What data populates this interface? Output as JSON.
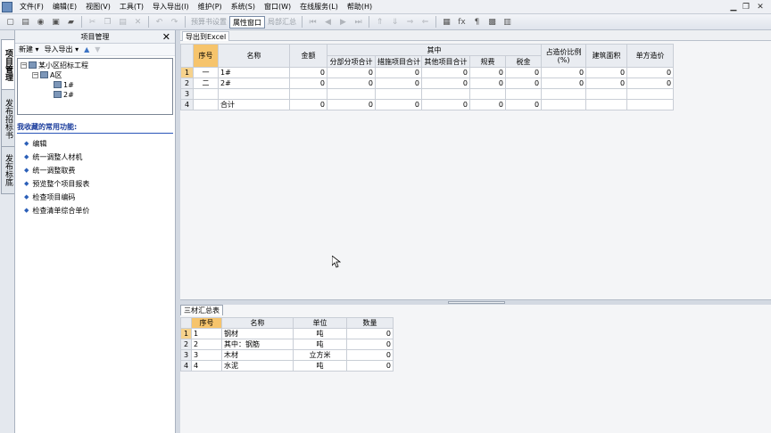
{
  "menubar": {
    "items": [
      "文件(F)",
      "编辑(E)",
      "视图(V)",
      "工具(T)",
      "导入导出(I)",
      "维护(P)",
      "系统(S)",
      "窗口(W)",
      "在线服务(L)",
      "帮助(H)"
    ],
    "minimize_glyph": "▁",
    "restore_glyph": "❐",
    "close_glyph": "✕"
  },
  "toolbar": {
    "set_tender_label": "预算书设置",
    "property_window_label": "属性窗口",
    "summary_label": "局部汇总",
    "fx_label": "fx",
    "para_label": "¶"
  },
  "side_tabs": [
    {
      "label": "项目管理"
    },
    {
      "label": "发布招标书"
    },
    {
      "label": "发布标底"
    }
  ],
  "left_panel": {
    "title": "项目管理",
    "close_glyph": "✕",
    "tools": {
      "new": "新建 ▾",
      "import_export": "导入导出 ▾"
    },
    "tree": {
      "root": "某小区招标工程",
      "zone": "A区",
      "bldg1": "1#",
      "bldg2": "2#"
    },
    "favorites_title": "我收藏的常用功能:",
    "favorites": [
      "编辑",
      "统一调整人材机",
      "统一调整取费",
      "预览整个项目报表",
      "检查项目编码",
      "检查清单综合单价"
    ]
  },
  "main_grid": {
    "tab_label": "导出到Excel",
    "headers": {
      "seq": "序号",
      "name": "名称",
      "amount": "金额",
      "group": "其中",
      "sub1": "分部分项合计",
      "sub2": "措施项目合计",
      "sub3": "其他项目合计",
      "sub4": "规费",
      "sub5": "税金",
      "ratio": "占造价比例(%)",
      "area": "建筑面积",
      "unit_price": "单方造价"
    },
    "rows": [
      {
        "rh": "1",
        "seq": "一",
        "name": "1#",
        "amount": "0",
        "s1": "0",
        "s2": "0",
        "s3": "0",
        "s4": "0",
        "s5": "0",
        "ratio": "0",
        "area": "0",
        "up": "0"
      },
      {
        "rh": "2",
        "seq": "二",
        "name": "2#",
        "amount": "0",
        "s1": "0",
        "s2": "0",
        "s3": "0",
        "s4": "0",
        "s5": "0",
        "ratio": "0",
        "area": "0",
        "up": "0"
      },
      {
        "rh": "3",
        "seq": "",
        "name": "",
        "amount": "",
        "s1": "",
        "s2": "",
        "s3": "",
        "s4": "",
        "s5": "",
        "ratio": "",
        "area": "",
        "up": ""
      },
      {
        "rh": "4",
        "seq": "",
        "name": "合计",
        "amount": "0",
        "s1": "0",
        "s2": "0",
        "s3": "0",
        "s4": "0",
        "s5": "0",
        "ratio": "",
        "area": "",
        "up": ""
      }
    ]
  },
  "material_grid": {
    "tab_label": "三材汇总表",
    "headers": {
      "seq": "序号",
      "name": "名称",
      "unit": "单位",
      "qty": "数量"
    },
    "rows": [
      {
        "rh": "1",
        "seq": "1",
        "name": "钢材",
        "unit": "吨",
        "qty": "0"
      },
      {
        "rh": "2",
        "seq": "2",
        "name": "其中：钢筋",
        "unit": "吨",
        "qty": "0"
      },
      {
        "rh": "3",
        "seq": "3",
        "name": "木材",
        "unit": "立方米",
        "qty": "0"
      },
      {
        "rh": "4",
        "seq": "4",
        "name": "水泥",
        "unit": "吨",
        "qty": "0"
      }
    ]
  }
}
